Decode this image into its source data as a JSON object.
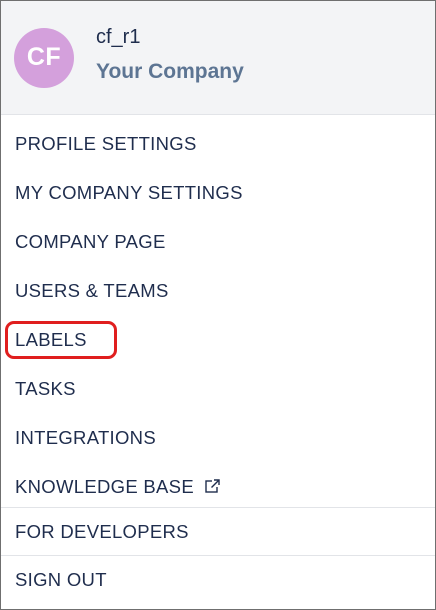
{
  "header": {
    "avatar_initials": "CF",
    "avatar_color": "#d4a0dc",
    "username": "cf_r1",
    "company": "Your Company"
  },
  "menu": {
    "items": [
      {
        "label": "PROFILE SETTINGS"
      },
      {
        "label": "MY COMPANY SETTINGS"
      },
      {
        "label": "COMPANY PAGE"
      },
      {
        "label": "USERS & TEAMS"
      },
      {
        "label": "LABELS",
        "highlighted": true
      },
      {
        "label": "TASKS"
      },
      {
        "label": "INTEGRATIONS"
      },
      {
        "label": "KNOWLEDGE BASE",
        "icon": "external-link-icon"
      }
    ],
    "developers_label": "FOR DEVELOPERS",
    "sign_out_label": "SIGN OUT"
  },
  "colors": {
    "text": "#1f2d4d",
    "company_text": "#5d7593",
    "highlight_border": "#e01e1e",
    "header_bg": "#f3f4f6"
  }
}
